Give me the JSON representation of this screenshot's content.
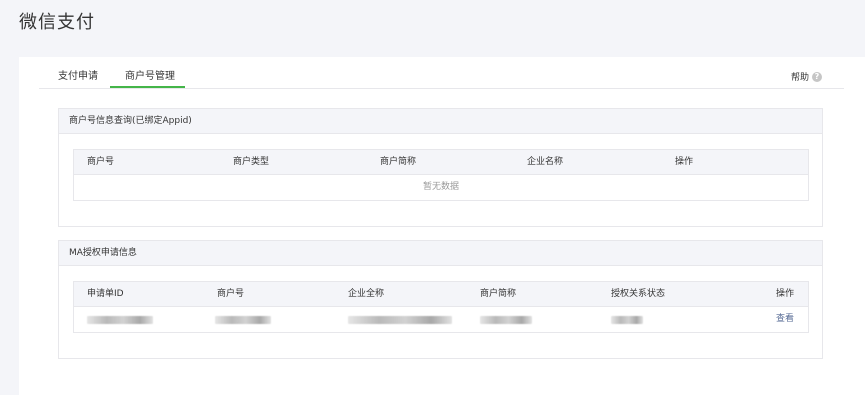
{
  "page": {
    "title": "微信支付"
  },
  "tabs": [
    {
      "label": "支付申请"
    },
    {
      "label": "商户号管理"
    }
  ],
  "help": {
    "label": "帮助",
    "icon": "question-circle-icon"
  },
  "merchant_section": {
    "title": "商户号信息查询(已绑定Appid)",
    "columns": [
      "商户号",
      "商户类型",
      "商户简称",
      "企业名称",
      "操作"
    ],
    "empty_text": "暂无数据"
  },
  "ma_section": {
    "title": "MA授权申请信息",
    "columns": [
      "申请单ID",
      "商户号",
      "企业全称",
      "商户简称",
      "授权关系状态",
      "操作"
    ],
    "rows": [
      {
        "action": "查看"
      }
    ]
  },
  "colors": {
    "accent": "#44b549",
    "link": "#576b95"
  }
}
